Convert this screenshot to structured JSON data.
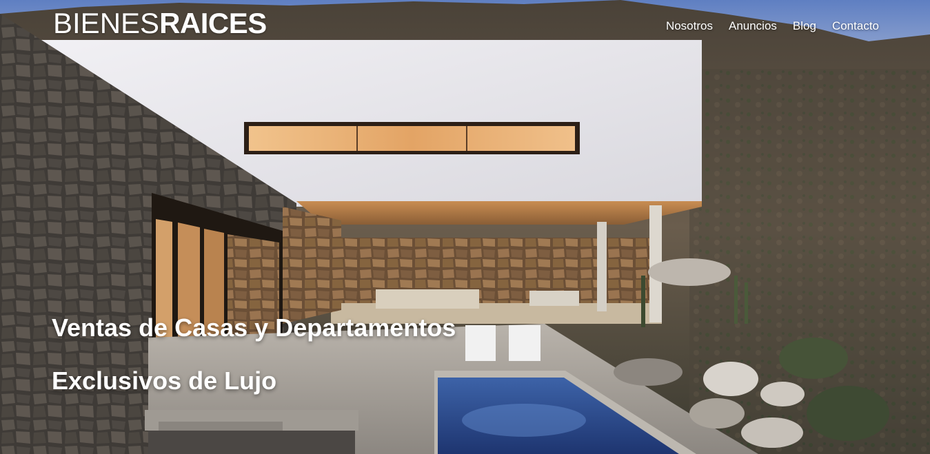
{
  "header": {
    "logo_light": "BIENES",
    "logo_bold": "RAICES"
  },
  "nav": {
    "items": [
      {
        "label": "Nosotros"
      },
      {
        "label": "Anuncios"
      },
      {
        "label": "Blog"
      },
      {
        "label": "Contacto"
      }
    ]
  },
  "hero": {
    "line1": "Ventas de Casas y Departamentos",
    "line2": "Exclusivos de Lujo"
  },
  "colors": {
    "text": "#ffffff",
    "sky": "#7c95c8",
    "wall_white": "#e8e7ec",
    "stone": "#4a4641",
    "warm_light": "#e2a86a",
    "pool": "#2d4a8c",
    "hillside": "#5b5447"
  }
}
